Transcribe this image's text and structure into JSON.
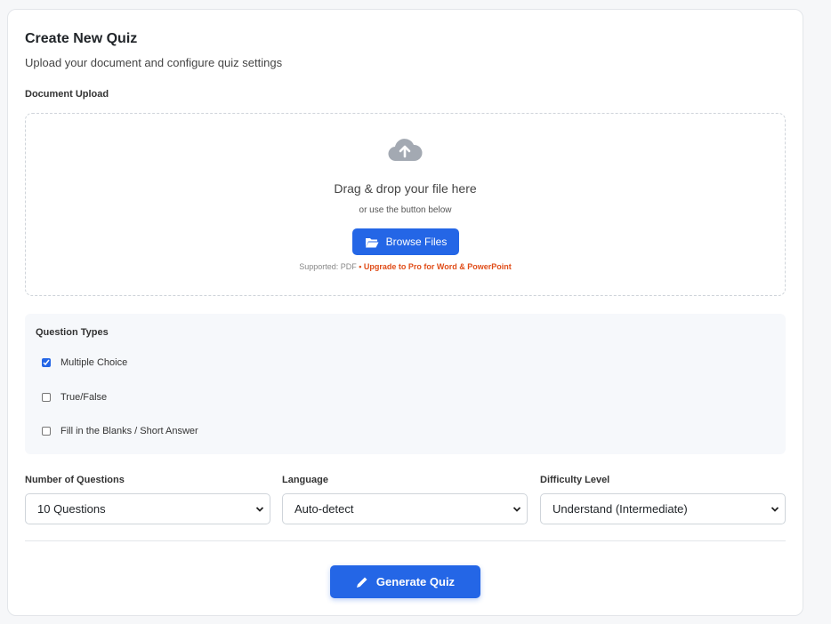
{
  "header": {
    "title": "Create New Quiz",
    "subtitle": "Upload your document and configure quiz settings"
  },
  "upload": {
    "section_label": "Document Upload",
    "icon": "cloud-upload-icon",
    "drop_title": "Drag & drop your file here",
    "drop_subtitle": "or use the button below",
    "browse_label": "Browse Files",
    "browse_icon": "folder-open-icon",
    "supported_text": "Supported: PDF",
    "separator": " • ",
    "upgrade_text": "Upgrade to Pro for Word & PowerPoint"
  },
  "question_types": {
    "label": "Question Types",
    "items": [
      {
        "label": "Multiple Choice",
        "checked": true
      },
      {
        "label": "True/False",
        "checked": false
      },
      {
        "label": "Fill in the Blanks / Short Answer",
        "checked": false
      }
    ]
  },
  "settings": {
    "num_questions": {
      "label": "Number of Questions",
      "value": "10 Questions"
    },
    "language": {
      "label": "Language",
      "value": "Auto-detect"
    },
    "difficulty": {
      "label": "Difficulty Level",
      "value": "Understand (Intermediate)"
    }
  },
  "actions": {
    "generate_label": "Generate Quiz",
    "generate_icon": "pencil-icon"
  },
  "colors": {
    "accent": "#2466e6",
    "upgrade": "#e04d19"
  }
}
